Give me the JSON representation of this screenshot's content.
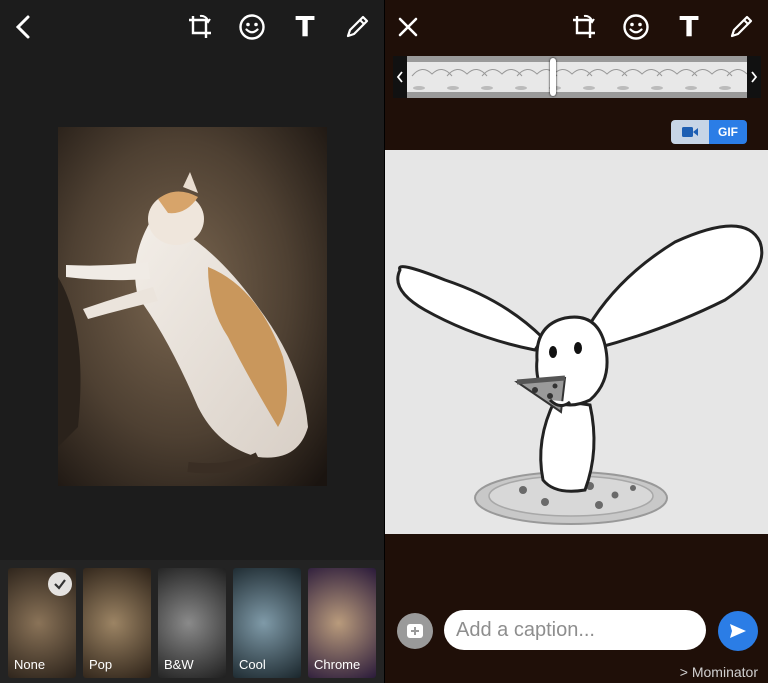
{
  "left_editor": {
    "toolbar": {
      "back": "back-icon",
      "crop": "crop-rotate-icon",
      "emoji": "emoji-icon",
      "text_glyph": "T",
      "draw": "pencil-icon"
    },
    "filters": [
      {
        "label": "None",
        "selected": true
      },
      {
        "label": "Pop",
        "selected": false
      },
      {
        "label": "B&W",
        "selected": false
      },
      {
        "label": "Cool",
        "selected": false
      },
      {
        "label": "Chrome",
        "selected": false
      }
    ]
  },
  "right_editor": {
    "toolbar": {
      "close": "close-icon",
      "crop": "crop-rotate-icon",
      "emoji": "emoji-icon",
      "text_glyph": "T",
      "draw": "pencil-icon"
    },
    "format_toggle": {
      "video_icon": "video-camera-icon",
      "gif_label": "GIF",
      "selected": "GIF"
    },
    "caption": {
      "placeholder": "Add a caption..."
    },
    "recipient": {
      "prefix": ">",
      "name": "Mominator"
    },
    "colors": {
      "accent": "#2b7de6",
      "background": "#1f0f08"
    }
  }
}
